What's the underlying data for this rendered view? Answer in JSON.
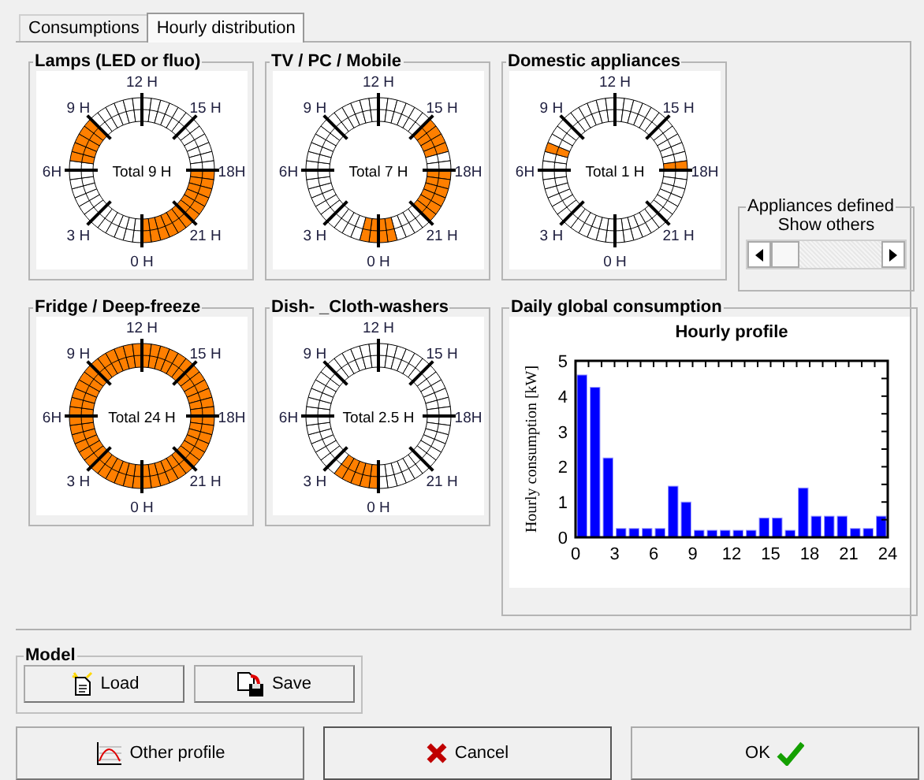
{
  "tabs": [
    {
      "label": "Consumptions",
      "selected": false
    },
    {
      "label": "Hourly distribution",
      "selected": true
    }
  ],
  "appliances": [
    {
      "title": "Lamps (LED or fluo)",
      "total": "Total 9 H",
      "hour_labels": [
        "0 H",
        "3 H",
        "6H",
        "9 H",
        "12 H",
        "15 H",
        "18H",
        "21 H"
      ],
      "half_hours": [
        false,
        false,
        false,
        false,
        false,
        false,
        false,
        false,
        false,
        false,
        false,
        false,
        false,
        true,
        true,
        true,
        true,
        true,
        false,
        false,
        false,
        false,
        false,
        false,
        false,
        false,
        false,
        false,
        false,
        false,
        false,
        false,
        false,
        false,
        false,
        false,
        true,
        true,
        true,
        true,
        true,
        true,
        true,
        true,
        true,
        true,
        true,
        true
      ]
    },
    {
      "title": "TV / PC / Mobile",
      "total": "Total 7 H",
      "hour_labels": [
        "0 H",
        "3 H",
        "6H",
        "9 H",
        "12 H",
        "15 H",
        "18H",
        "21 H"
      ],
      "half_hours": [
        true,
        true,
        false,
        false,
        false,
        false,
        false,
        false,
        false,
        false,
        false,
        false,
        false,
        false,
        false,
        false,
        false,
        false,
        false,
        false,
        false,
        false,
        false,
        false,
        false,
        false,
        false,
        false,
        false,
        false,
        true,
        true,
        true,
        true,
        false,
        false,
        true,
        true,
        true,
        true,
        true,
        true,
        false,
        false,
        false,
        false,
        true,
        true
      ]
    },
    {
      "title": "Domestic appliances",
      "total": "Total 1 H",
      "hour_labels": [
        "0 H",
        "3 H",
        "6H",
        "9 H",
        "12 H",
        "15 H",
        "18H",
        "21 H"
      ],
      "half_hours": [
        false,
        false,
        false,
        false,
        false,
        false,
        false,
        false,
        false,
        false,
        false,
        false,
        false,
        false,
        true,
        false,
        false,
        false,
        false,
        false,
        false,
        false,
        false,
        false,
        false,
        false,
        false,
        false,
        false,
        false,
        false,
        false,
        false,
        false,
        false,
        true,
        false,
        false,
        false,
        false,
        false,
        false,
        false,
        false,
        false,
        false,
        false,
        false
      ]
    },
    {
      "title": "Fridge / Deep-freeze",
      "total": "Total 24 H",
      "hour_labels": [
        "0 H",
        "3 H",
        "6H",
        "9 H",
        "12 H",
        "15 H",
        "18H",
        "21 H"
      ],
      "half_hours": [
        true,
        true,
        true,
        true,
        true,
        true,
        true,
        true,
        true,
        true,
        true,
        true,
        true,
        true,
        true,
        true,
        true,
        true,
        true,
        true,
        true,
        true,
        true,
        true,
        true,
        true,
        true,
        true,
        true,
        true,
        true,
        true,
        true,
        true,
        true,
        true,
        true,
        true,
        true,
        true,
        true,
        true,
        true,
        true,
        true,
        true,
        true,
        true
      ]
    },
    {
      "title": "Dish- _Cloth-washers",
      "total": "Total 2.5 H",
      "hour_labels": [
        "0 H",
        "3 H",
        "6H",
        "9 H",
        "12 H",
        "15 H",
        "18H",
        "21 H"
      ],
      "half_hours": [
        true,
        true,
        true,
        true,
        true,
        false,
        false,
        false,
        false,
        false,
        false,
        false,
        false,
        false,
        false,
        false,
        false,
        false,
        false,
        false,
        false,
        false,
        false,
        false,
        false,
        false,
        false,
        false,
        false,
        false,
        false,
        false,
        false,
        false,
        false,
        false,
        false,
        false,
        false,
        false,
        false,
        false,
        false,
        false,
        false,
        false,
        false,
        false
      ]
    }
  ],
  "appliances_defined": {
    "title": "Appliances defined",
    "label": "Show others"
  },
  "daily": {
    "title": "Daily global consumption",
    "chart_data": {
      "type": "bar",
      "title": "Hourly profile",
      "ylabel": "Hourly consumption [kW]",
      "x": [
        0.5,
        1.5,
        2.5,
        3.5,
        4.5,
        5.5,
        6.5,
        7.5,
        8.5,
        9.5,
        10.5,
        11.5,
        12.5,
        13.5,
        14.5,
        15.5,
        16.5,
        17.5,
        18.5,
        19.5,
        20.5,
        21.5,
        22.5,
        23.5
      ],
      "values": [
        4.6,
        4.25,
        2.25,
        0.25,
        0.25,
        0.25,
        0.25,
        1.45,
        1.0,
        0.2,
        0.2,
        0.2,
        0.2,
        0.2,
        0.55,
        0.55,
        0.2,
        1.4,
        0.6,
        0.6,
        0.6,
        0.25,
        0.25,
        0.6
      ],
      "xlim": [
        0,
        24
      ],
      "ylim": [
        0,
        5
      ],
      "xticks": [
        0,
        3,
        6,
        9,
        12,
        15,
        18,
        21,
        24
      ],
      "yticks": [
        0,
        1,
        2,
        3,
        4,
        5
      ]
    }
  },
  "model": {
    "title": "Model",
    "buttons": [
      "Load",
      "Save"
    ]
  },
  "buttons": [
    {
      "label": "Other profile",
      "kind": "profile"
    },
    {
      "label": "Cancel",
      "kind": "cancel"
    },
    {
      "label": "OK",
      "kind": "ok"
    }
  ]
}
